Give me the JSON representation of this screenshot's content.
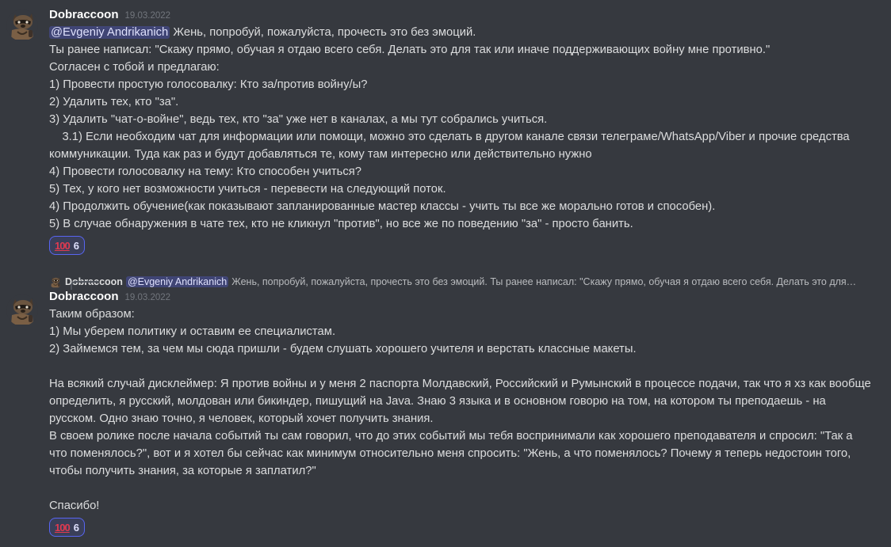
{
  "messages": [
    {
      "author": "Dobraccoon",
      "timestamp": "19.03.2022",
      "mention": "@Evgeniy Andrikanich",
      "lines": [
        " Жень, попробуй, пожалуйста, прочесть это без эмоций.",
        "Ты ранее написал: \"Скажу прямо, обучая я отдаю всего себя. Делать это для так или иначе поддерживающих войну мне противно.\"",
        "Согласен с тобой и предлагаю:",
        "1) Провести простую голосовалку: Кто за/против войну/ы?",
        "2) Удалить тех, кто \"за\".",
        "3) Удалить \"чат-о-войне\", ведь тех, кто \"за\" уже нет в каналах, а мы тут собрались учиться.",
        "    3.1) Если необходим чат для информации или помощи, можно это сделать в другом канале связи телеграме/WhatsApp/Viber и прочие средства",
        "коммуникации. Туда как раз и будут добавляться те, кому там интересно или действительно нужно",
        "4) Провести голосовалку на тему: Кто способен учиться?",
        "5) Тех, у кого нет возможности учиться - перевести на следующий поток.",
        "4) Продолжить обучение(как показывают запланированные мастер классы - учить ты все же морально готов и способен).",
        "5) В случае обнаружения в чате тех, кто не кликнул \"против\", но все же по поведению \"за\" - просто банить."
      ],
      "reaction": {
        "emoji": "100",
        "count": "6"
      }
    },
    {
      "reply": {
        "author": "Dobraccoon",
        "mention": "@Evgeniy Andrikanich",
        "text": "Жень, попробуй, пожалуйста, прочесть это без эмоций. Ты ранее написал: \"Скажу прямо, обучая я отдаю всего себя. Делать это для…"
      },
      "author": "Dobraccoon",
      "timestamp": "19.03.2022",
      "lines": [
        "Таким образом:",
        "1) Мы уберем политику и оставим ее специалистам.",
        "2) Займемся тем, за чем мы сюда пришли - будем слушать хорошего учителя и верстать классные макеты.",
        "",
        "На всякий случай дисклеймер: Я против войны и у меня 2 паспорта Молдавский, Российский и Румынский в процессе подачи, так что я хз как вообще",
        "определить, я русский, молдован или бикиндер, пишущий на Java. Знаю 3 языка и в основном говорю на том, на котором ты преподаешь - на",
        "русском. Одно знаю точно, я человек, который хочет получить знания.",
        "В своем ролике после начала событий ты сам говорил, что до этих событий мы тебя воспринимали как хорошего преподавателя и спросил: \"Так а",
        "что поменялось?\", вот и я хотел бы сейчас как минимум относительно меня спросить: \"Жень, а что поменялось? Почему я теперь недостоин того,",
        "чтобы получить знания, за которые я заплатил?\"",
        "",
        "Спасибо!"
      ],
      "reaction": {
        "emoji": "100",
        "count": "6"
      }
    }
  ]
}
